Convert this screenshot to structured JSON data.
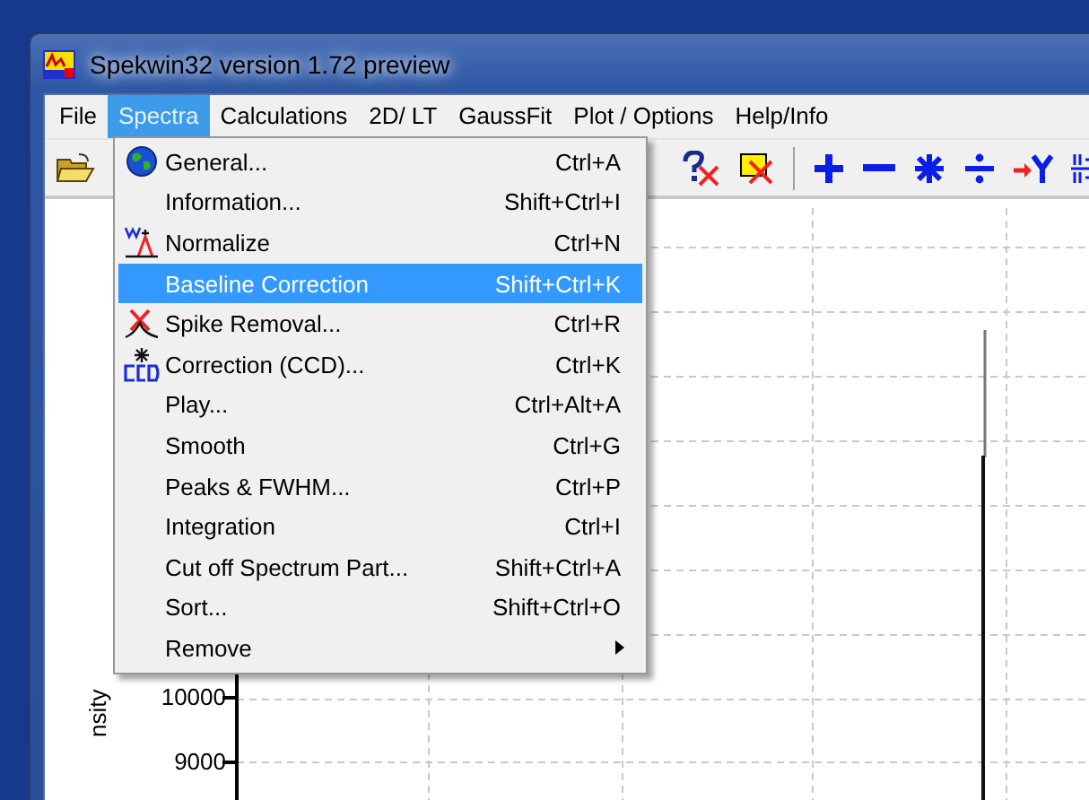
{
  "window": {
    "title": "Spekwin32 version 1.72 preview"
  },
  "menubar": [
    {
      "label": "File",
      "selected": false
    },
    {
      "label": "Spectra",
      "selected": true
    },
    {
      "label": "Calculations",
      "selected": false
    },
    {
      "label": "2D/ LT",
      "selected": false
    },
    {
      "label": "GaussFit",
      "selected": false
    },
    {
      "label": "Plot / Options",
      "selected": false
    },
    {
      "label": "Help/Info",
      "selected": false
    }
  ],
  "menu": [
    {
      "label": "General...",
      "shortcut": "Ctrl+A",
      "selected": false,
      "submenu": false
    },
    {
      "label": "Information...",
      "shortcut": "Shift+Ctrl+I",
      "selected": false,
      "submenu": false
    },
    {
      "label": "Normalize",
      "shortcut": "Ctrl+N",
      "selected": false,
      "submenu": false
    },
    {
      "label": "Baseline Correction",
      "shortcut": "Shift+Ctrl+K",
      "selected": true,
      "submenu": false
    },
    {
      "label": "Spike Removal...",
      "shortcut": "Ctrl+R",
      "selected": false,
      "submenu": false
    },
    {
      "label": "Correction (CCD)...",
      "shortcut": "Ctrl+K",
      "selected": false,
      "submenu": false
    },
    {
      "label": "Play...",
      "shortcut": "Ctrl+Alt+A",
      "selected": false,
      "submenu": false
    },
    {
      "label": "Smooth",
      "shortcut": "Ctrl+G",
      "selected": false,
      "submenu": false
    },
    {
      "label": "Peaks & FWHM...",
      "shortcut": "Ctrl+P",
      "selected": false,
      "submenu": false
    },
    {
      "label": "Integration",
      "shortcut": "Ctrl+I",
      "selected": false,
      "submenu": false
    },
    {
      "label": "Cut off Spectrum Part...",
      "shortcut": "Shift+Ctrl+A",
      "selected": false,
      "submenu": false
    },
    {
      "label": "Sort...",
      "shortcut": "Shift+Ctrl+O",
      "selected": false,
      "submenu": false
    },
    {
      "label": "Remove",
      "selected": false,
      "submenu": true
    }
  ],
  "plot": {
    "y_ticks": [
      "10000",
      "9000"
    ],
    "y_axis_label": "nsity"
  }
}
